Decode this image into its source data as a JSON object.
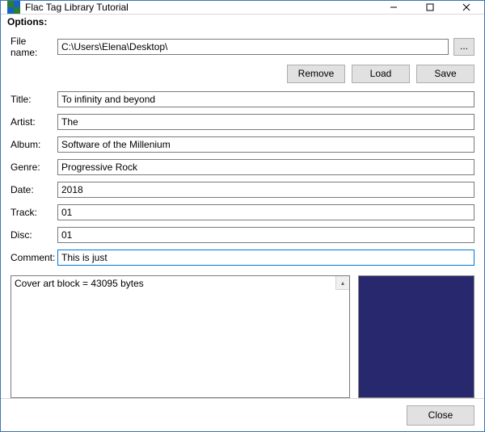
{
  "window": {
    "title": "Flac Tag Library Tutorial"
  },
  "menu": {
    "options": "Options:"
  },
  "labels": {
    "file_name": "File name:",
    "title": "Title:",
    "artist": "Artist:",
    "album": "Album:",
    "genre": "Genre:",
    "date": "Date:",
    "track": "Track:",
    "disc": "Disc:",
    "comment": "Comment:"
  },
  "fields": {
    "file_name": "C:\\Users\\Elena\\Desktop\\",
    "title": "To infinity and beyond",
    "artist": "The",
    "album": "Software of the Millenium",
    "genre": "Progressive Rock",
    "date": "2018",
    "track": "01",
    "disc": "01",
    "comment": "This is just"
  },
  "buttons": {
    "browse": "...",
    "remove": "Remove",
    "load": "Load",
    "save": "Save",
    "close": "Close"
  },
  "listbox": {
    "items": [
      "Cover art block = 43095 bytes"
    ]
  },
  "cover": {
    "color": "#27286e"
  }
}
